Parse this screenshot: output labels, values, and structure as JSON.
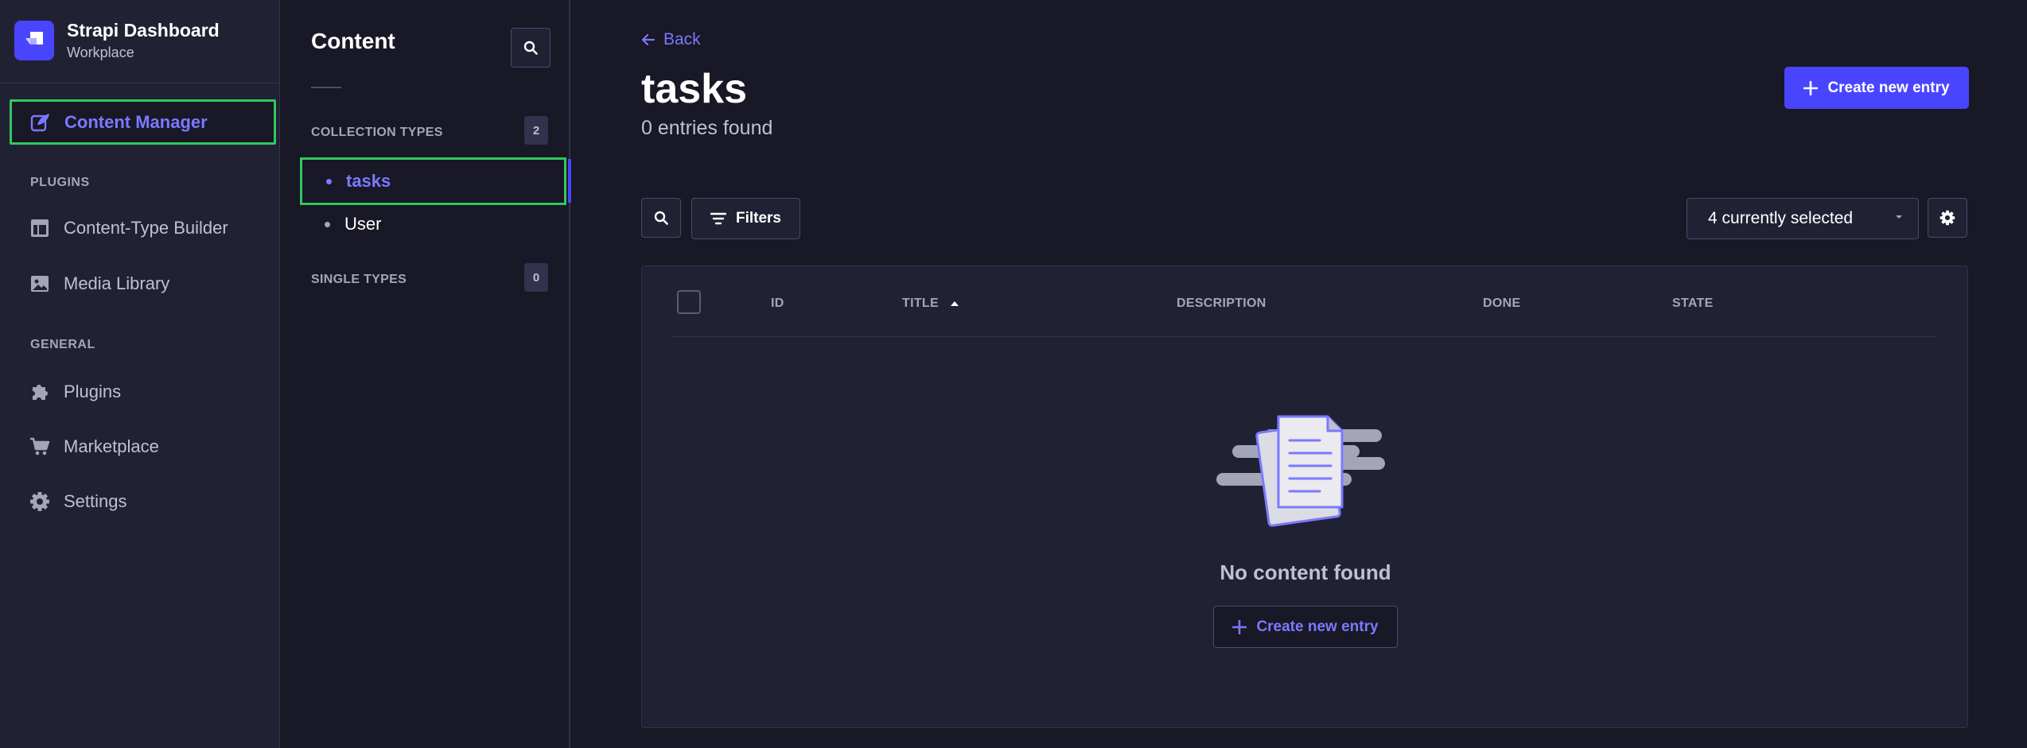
{
  "brand": {
    "title": "Strapi Dashboard",
    "subtitle": "Workplace"
  },
  "nav": {
    "content_manager": "Content Manager",
    "plugins_label": "PLUGINS",
    "content_type_builder": "Content-Type Builder",
    "media_library": "Media Library",
    "general_label": "GENERAL",
    "plugins": "Plugins",
    "marketplace": "Marketplace",
    "settings": "Settings"
  },
  "subnav": {
    "title": "Content",
    "collection_types_label": "COLLECTION TYPES",
    "collection_types_count": "2",
    "items": [
      "tasks",
      "User"
    ],
    "single_types_label": "SINGLE TYPES",
    "single_types_count": "0"
  },
  "main": {
    "back_label": "Back",
    "title": "tasks",
    "entries_found": "0 entries found",
    "create_new_entry": "Create new entry",
    "filters_label": "Filters",
    "columns_select": "4 currently selected",
    "table_headers": [
      "ID",
      "TITLE",
      "DESCRIPTION",
      "DONE",
      "STATE"
    ],
    "empty_text": "No content found",
    "empty_create": "Create new entry"
  },
  "colors": {
    "accent": "#4945ff",
    "accent_text": "#7b79ff",
    "highlight_outline": "#32c85c",
    "background": "#181826",
    "panel": "#212134"
  }
}
